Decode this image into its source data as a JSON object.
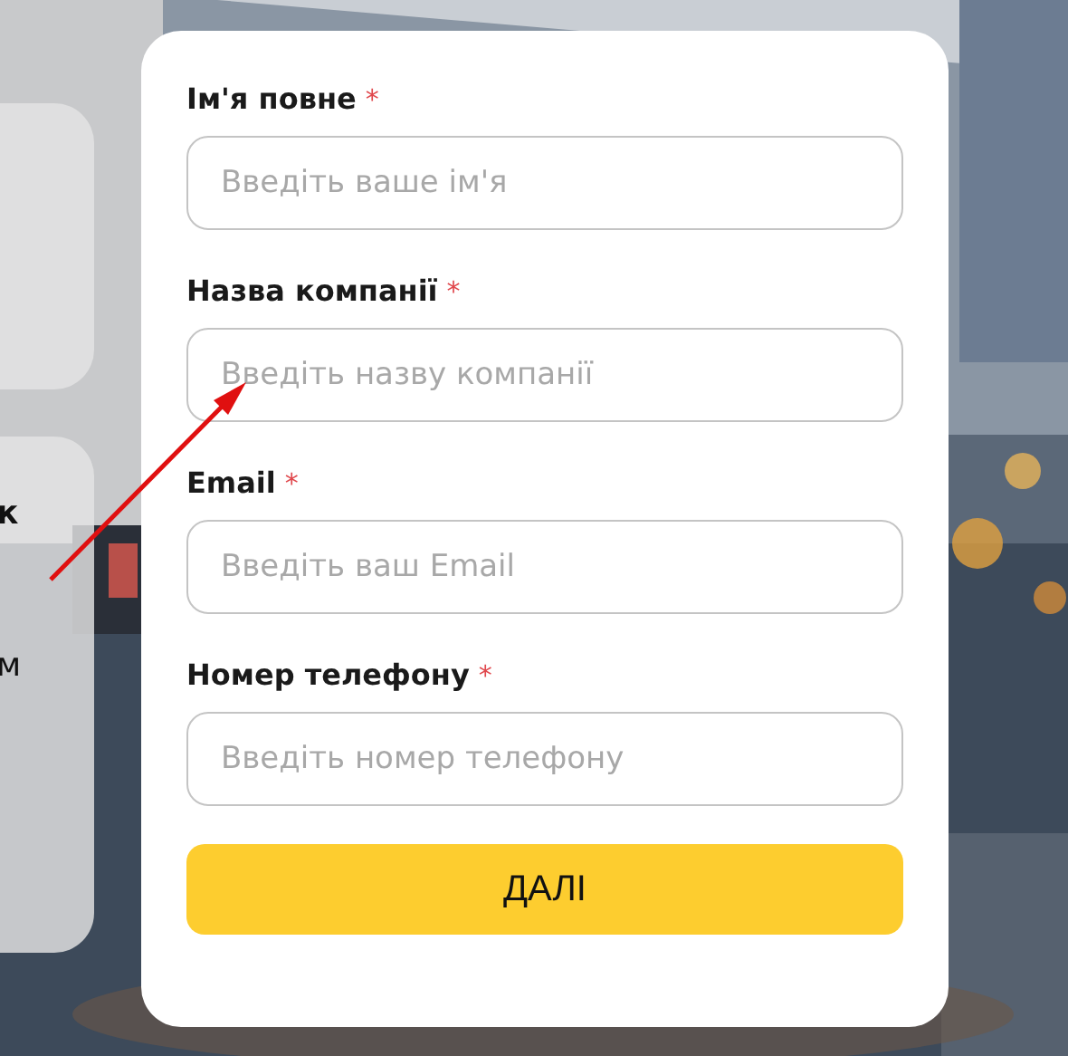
{
  "side_cards": [
    {
      "kind": "blank"
    },
    {
      "kind": "text",
      "lines": [
        "к",
        "м"
      ]
    }
  ],
  "form": {
    "fields": [
      {
        "label": "Ім'я повне",
        "required_mark": "*",
        "placeholder": "Введіть ваше ім'я"
      },
      {
        "label": "Назва компанії",
        "required_mark": "*",
        "placeholder": "Введіть назву компанії"
      },
      {
        "label": "Email",
        "required_mark": "*",
        "placeholder": "Введіть ваш Email"
      },
      {
        "label": "Номер телефону",
        "required_mark": "*",
        "placeholder": "Введіть номер телефону"
      }
    ],
    "submit": "ДАЛІ"
  },
  "annotation": {
    "kind": "arrow",
    "color": "#e01010"
  }
}
